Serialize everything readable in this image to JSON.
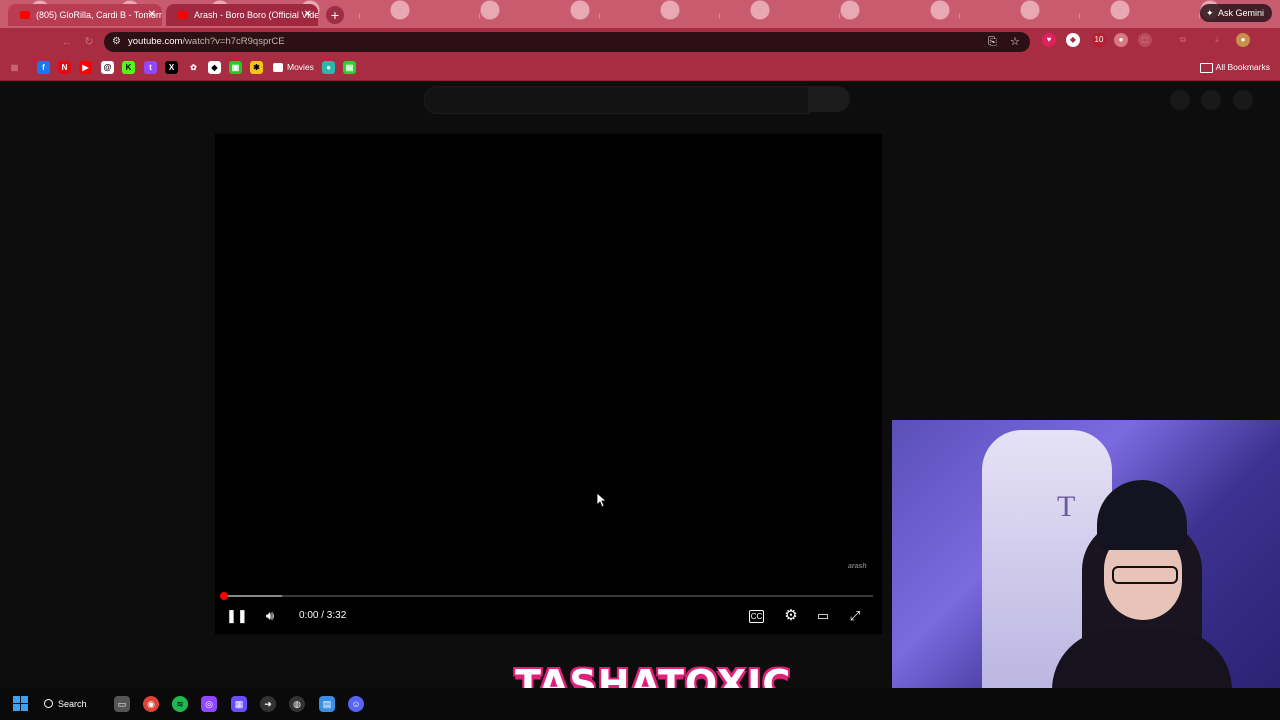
{
  "browser": {
    "tabs": [
      {
        "title": "(805) GloRilla, Cardi B - Tomorro",
        "close": "✕"
      },
      {
        "title": "Arash - Boro Boro (Official Vide",
        "close": "✕"
      }
    ],
    "new_tab": "+",
    "ask_gemini": "Ask Gemini",
    "url_host": "youtube.com",
    "url_path": "/watch?v=h7cR9qsprCE",
    "bookmarks": {
      "movies": "Movies",
      "all": "All Bookmarks"
    },
    "extension_badge": "10"
  },
  "player": {
    "time": "0:00 / 3:32",
    "watermark": "arash",
    "progress_buffered_fraction": 0.09
  },
  "overlay": {
    "brand": "TASHATOXIC"
  },
  "taskbar": {
    "search_label": "Search"
  }
}
